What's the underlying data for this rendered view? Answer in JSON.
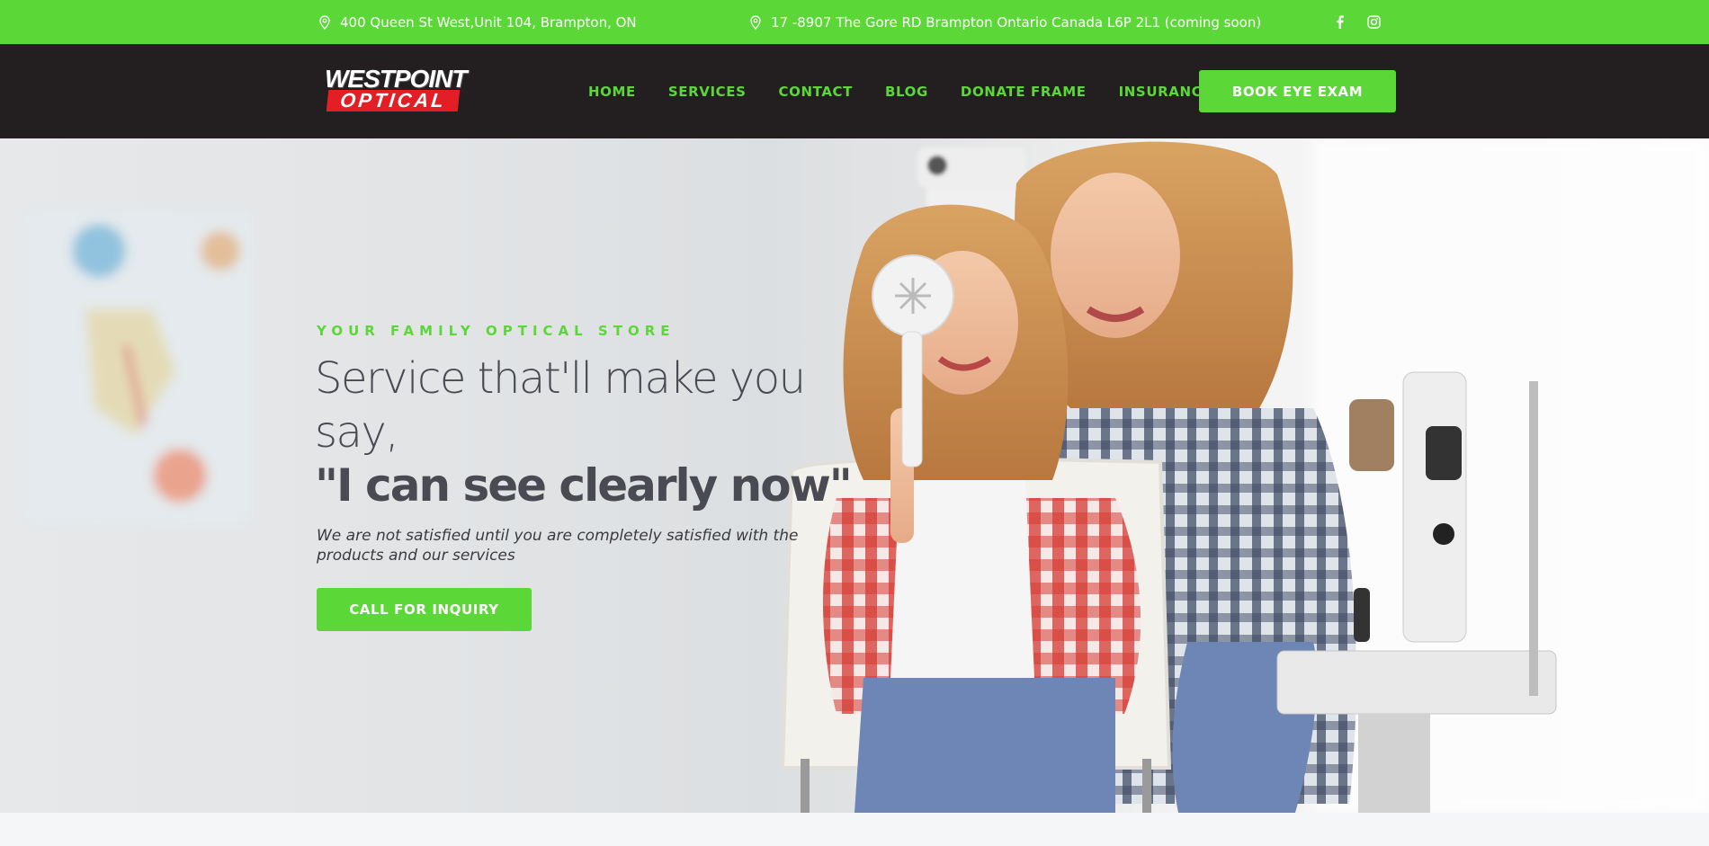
{
  "topbar": {
    "address1": "400 Queen St West,Unit 104, Brampton, ON",
    "address2": "17 -8907 The Gore RD Brampton Ontario Canada L6P 2L1 (coming soon)",
    "social": [
      "facebook-icon",
      "instagram-icon"
    ]
  },
  "logo": {
    "line1": "WESTPOINT",
    "line2": "OPTICAL"
  },
  "nav": {
    "items": [
      "HOME",
      "SERVICES",
      "CONTACT",
      "BLOG",
      "DONATE FRAME",
      "INSURANCE"
    ],
    "cta": "BOOK EYE EXAM"
  },
  "hero": {
    "tagline": "YOUR FAMILY OPTICAL STORE",
    "heading_light": "Service that'll make you say,",
    "heading_bold": "\"I can see clearly now\"",
    "subtext": "We are not satisfied until you are completely satisfied with the products and our services",
    "cta": "CALL FOR INQUIRY"
  },
  "colors": {
    "accent": "#5bd838",
    "nav_bg": "#231f20",
    "heading": "#4a4a52",
    "logo_red": "#e31e24"
  }
}
